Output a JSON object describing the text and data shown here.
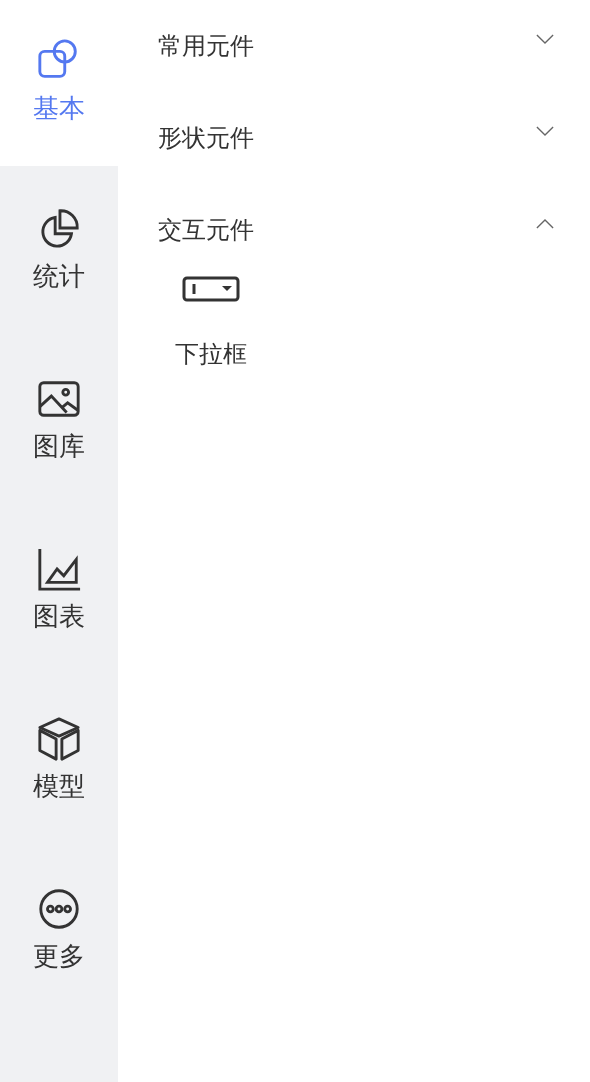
{
  "sidebar": {
    "items": [
      {
        "label": "基本",
        "selected": true
      },
      {
        "label": "统计",
        "selected": false
      },
      {
        "label": "图库",
        "selected": false
      },
      {
        "label": "图表",
        "selected": false
      },
      {
        "label": "模型",
        "selected": false
      },
      {
        "label": "更多",
        "selected": false
      }
    ]
  },
  "sections": [
    {
      "title": "常用元件",
      "expanded": false
    },
    {
      "title": "形状元件",
      "expanded": false
    },
    {
      "title": "交互元件",
      "expanded": true,
      "items": [
        {
          "label": "下拉框"
        }
      ]
    }
  ]
}
